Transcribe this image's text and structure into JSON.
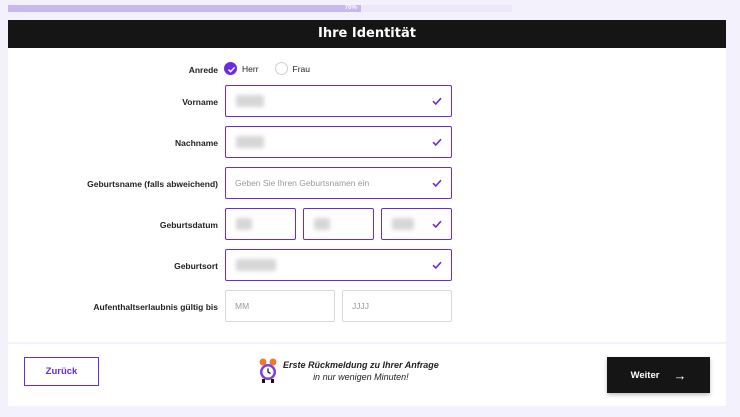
{
  "progress": {
    "label": "70%",
    "value": 0.7
  },
  "header": {
    "title": "Ihre Identität"
  },
  "anrede": {
    "label": "Anrede",
    "options": [
      "Herr",
      "Frau"
    ],
    "selected": "Herr"
  },
  "fields": {
    "vorname": {
      "label": "Vorname"
    },
    "nachname": {
      "label": "Nachname"
    },
    "geburtsname": {
      "label": "Geburtsname (falls abweichend)",
      "placeholder": "Geben Sie Ihren Geburtsnamen ein"
    },
    "geburtsdatum": {
      "label": "Geburtsdatum"
    },
    "geburtsort": {
      "label": "Geburtsort"
    },
    "aufenthalt": {
      "label": "Aufenthaltserlaubnis gültig bis",
      "placeholder_month": "MM",
      "placeholder_year": "JJJJ"
    }
  },
  "footer": {
    "back_label": "Zurück",
    "message_line1": "Erste Rückmeldung zu Ihrer Anfrage",
    "message_line2": "in nur wenigen Minuten!",
    "next_label": "Weiter",
    "next_arrow": "→"
  },
  "colors": {
    "accent": "#6a2be0",
    "dark": "#151515",
    "progress": "#c9b7f2"
  }
}
